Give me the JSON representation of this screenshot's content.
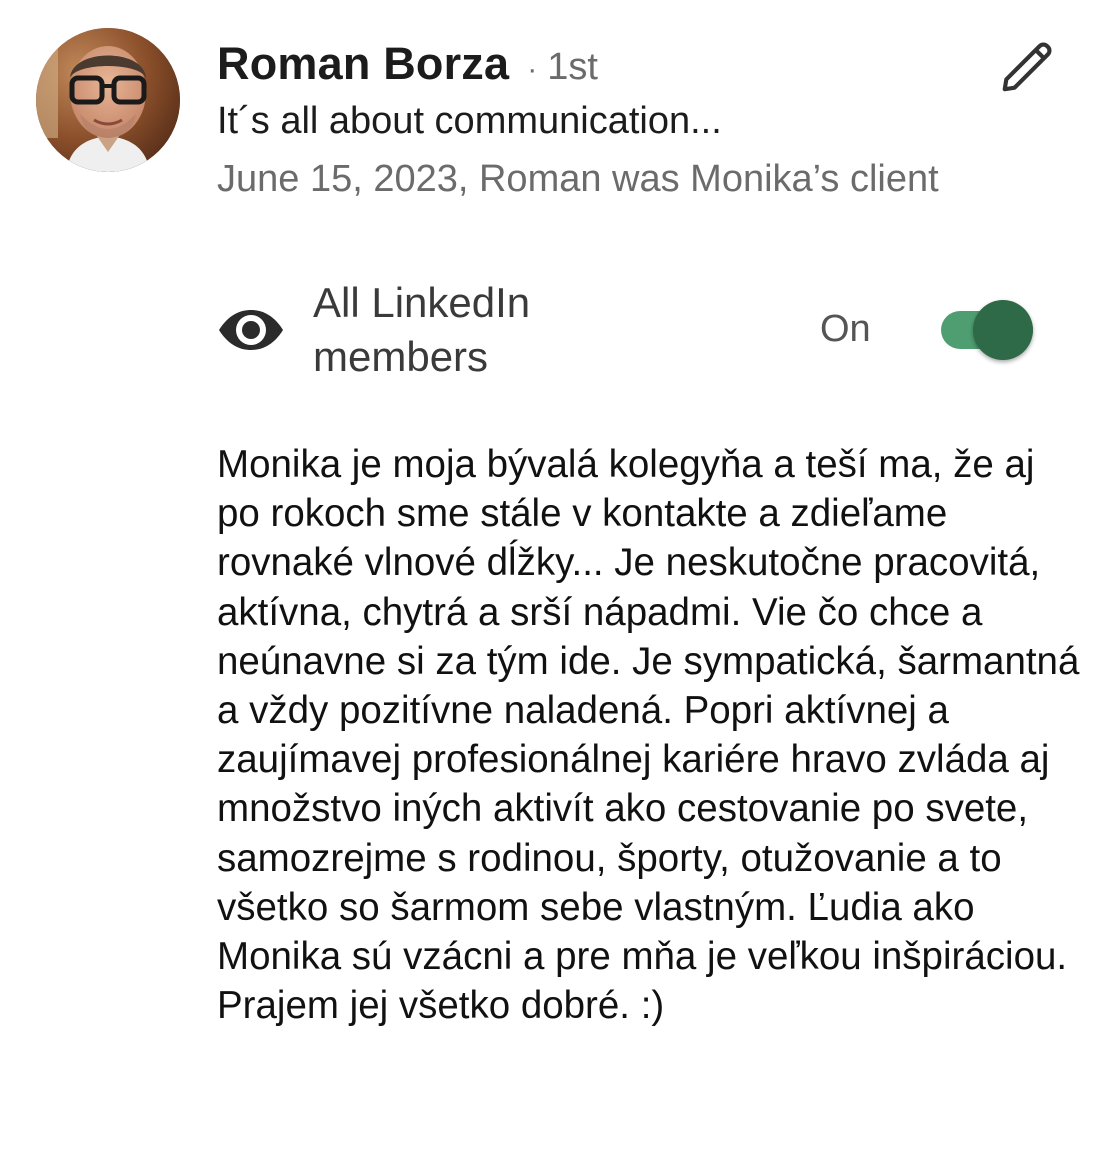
{
  "recommendation": {
    "author_name": "Roman Borza",
    "separator": "·",
    "connection_degree": "1st",
    "headline": "It´s all about communication...",
    "meta": "June 15, 2023, Roman was Monika’s client",
    "visibility": {
      "icon": "eye-icon",
      "label": "All LinkedIn members",
      "status": "On",
      "enabled": true
    },
    "text": "Monika je moja bývalá kolegyňa a teší ma, že aj po rokoch sme stále v kontakte a zdieľame rovnaké vlnové dĺžky... Je neskutočne pracovitá, aktívna, chytrá a srší nápadmi. Vie čo chce a neúnavne si za tým ide. Je sympatická, šarmantná a vždy pozitívne naladená. Popri aktívnej a zaujímavej profesionálnej kariére hravo zvláda aj množstvo iných aktivít ako cestovanie po svete, samozrejme s rodinou, športy, otužovanie a to všetko so šarmom sebe vlastným.  Ľudia ako Monika sú vzácni a pre mňa je veľkou inšpiráciou. Prajem jej všetko dobré. :)"
  },
  "icons": {
    "edit": "pencil-icon",
    "avatar": "avatar"
  },
  "colors": {
    "toggle_track": "#4f9e72",
    "toggle_knob": "#2e6a47",
    "secondary_text": "#6b6b6b"
  }
}
